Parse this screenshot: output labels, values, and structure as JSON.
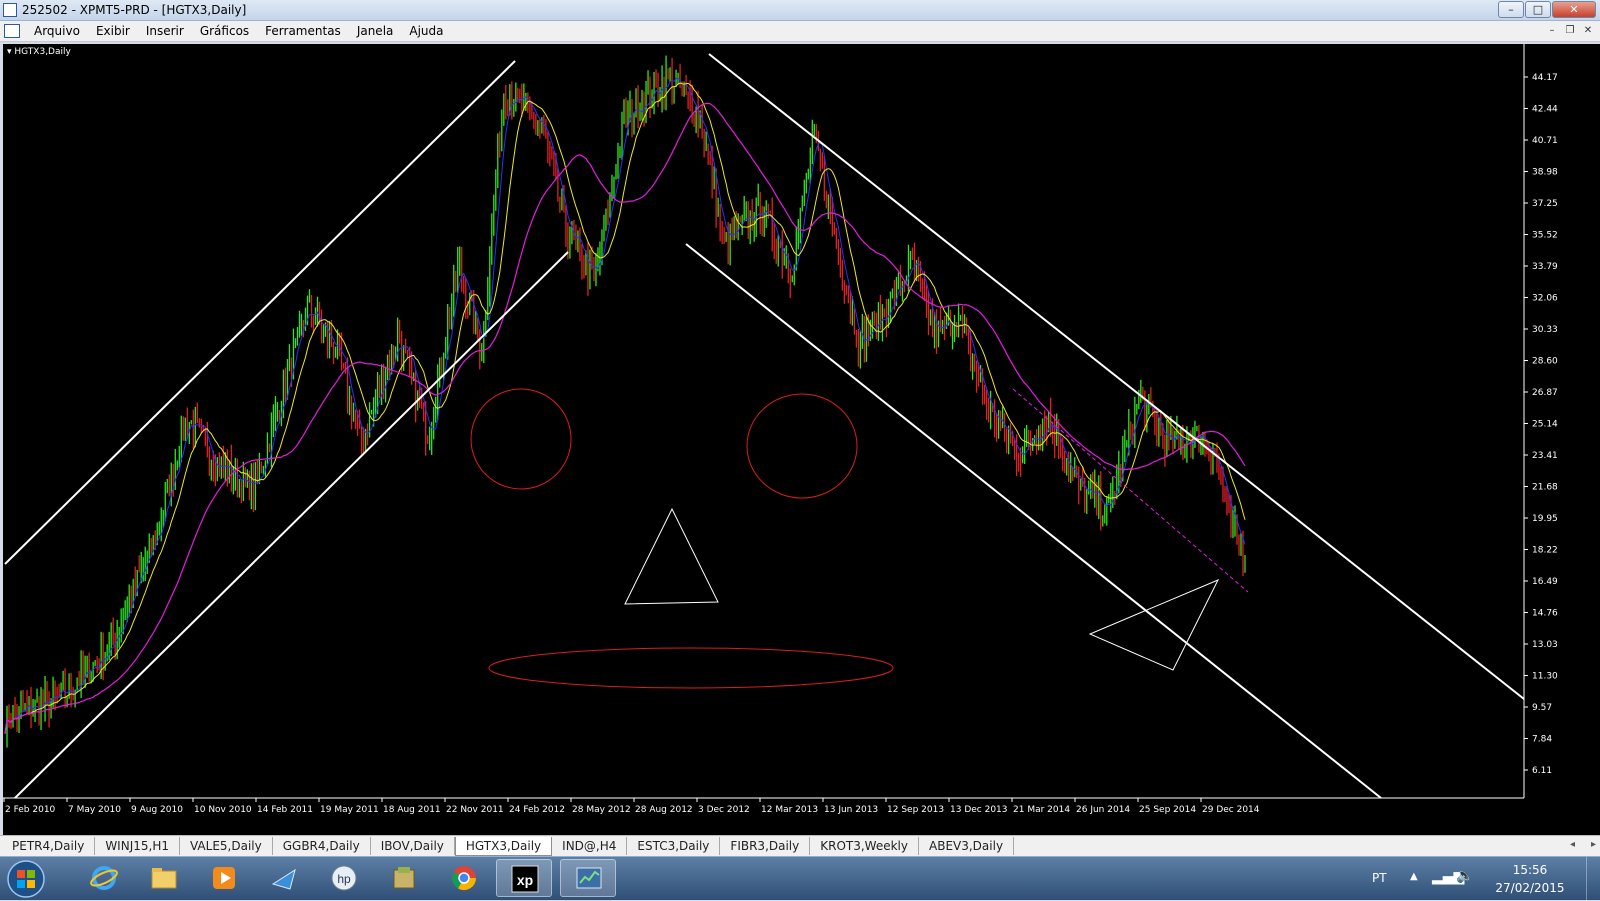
{
  "window": {
    "title": "252502 - XPMT5-PRD - [HGTX3,Daily]",
    "minimize": "–",
    "maximize": "□",
    "close": "✕"
  },
  "menu": {
    "items": [
      "Arquivo",
      "Exibir",
      "Inserir",
      "Gráficos",
      "Ferramentas",
      "Janela",
      "Ajuda"
    ],
    "mdi_minimize": "–",
    "mdi_restore": "❐",
    "mdi_close": "✕"
  },
  "chart": {
    "symbol_label": "HGTX3,Daily",
    "price_levels": [
      "44.17",
      "42.44",
      "40.71",
      "38.98",
      "37.25",
      "35.52",
      "33.79",
      "32.06",
      "30.33",
      "28.60",
      "26.87",
      "25.14",
      "23.41",
      "21.68",
      "19.95",
      "18.22",
      "16.49",
      "14.76",
      "13.03",
      "11.30",
      "9.57",
      "7.84",
      "6.11"
    ],
    "date_labels": [
      "2 Feb 2010",
      "7 May 2010",
      "9 Aug 2010",
      "10 Nov 2010",
      "14 Feb 2011",
      "19 May 2011",
      "18 Aug 2011",
      "22 Nov 2011",
      "24 Feb 2012",
      "28 May 2012",
      "28 Aug 2012",
      "3 Dec 2012",
      "12 Mar 2013",
      "13 Jun 2013",
      "12 Sep 2013",
      "13 Dec 2013",
      "21 Mar 2014",
      "26 Jun 2014",
      "25 Sep 2014",
      "29 Dec 2014"
    ],
    "close_anchors": [
      [
        0,
        8.9
      ],
      [
        0.04,
        10.2
      ],
      [
        0.07,
        13
      ],
      [
        0.1,
        19
      ],
      [
        0.12,
        25.5
      ],
      [
        0.14,
        23
      ],
      [
        0.165,
        21.5
      ],
      [
        0.2,
        31.5
      ],
      [
        0.22,
        29
      ],
      [
        0.235,
        24
      ],
      [
        0.26,
        30
      ],
      [
        0.28,
        24.5
      ],
      [
        0.3,
        34
      ],
      [
        0.315,
        29
      ],
      [
        0.33,
        43.5
      ],
      [
        0.355,
        41.5
      ],
      [
        0.37,
        36
      ],
      [
        0.39,
        33
      ],
      [
        0.41,
        42
      ],
      [
        0.44,
        44.2
      ],
      [
        0.46,
        42
      ],
      [
        0.475,
        35
      ],
      [
        0.5,
        37
      ],
      [
        0.52,
        33.5
      ],
      [
        0.535,
        41
      ],
      [
        0.55,
        35
      ],
      [
        0.565,
        29.5
      ],
      [
        0.58,
        31
      ],
      [
        0.6,
        34
      ],
      [
        0.615,
        30
      ],
      [
        0.63,
        31
      ],
      [
        0.65,
        26
      ],
      [
        0.67,
        23.5
      ],
      [
        0.69,
        25.5
      ],
      [
        0.71,
        21.5
      ],
      [
        0.73,
        20.5
      ],
      [
        0.75,
        26.5
      ],
      [
        0.77,
        24
      ],
      [
        0.79,
        24.5
      ],
      [
        0.8,
        23.5
      ],
      [
        0.81,
        19.5
      ],
      [
        0.82,
        18
      ]
    ],
    "colors": {
      "background": "#000000",
      "candles": "#2ee81e",
      "candles_down": "#e22121",
      "ma_fast": "#2433ff",
      "ma_mid": "#f0ea1e",
      "ma_slow": "#e21edd",
      "trendlines": "#ffffff",
      "face_red": "#d81e1e",
      "channel_dash": "#e21edd"
    }
  },
  "tabs": [
    "PETR4,Daily",
    "WINJ15,H1",
    "VALE5,Daily",
    "GGBR4,Daily",
    "IBOV,Daily",
    "HGTX3,Daily",
    "IND@,H4",
    "ESTC3,Daily",
    "FIBR3,Daily",
    "KROT3,Weekly",
    "ABEV3,Daily"
  ],
  "active_tab": "HGTX3,Daily",
  "tabs_nav": {
    "left": "◂",
    "right": "▸"
  },
  "taskbar": {
    "icons": [
      "windows-start-icon",
      "internet-explorer-icon",
      "file-explorer-icon",
      "media-player-icon",
      "network-app-icon",
      "hp-icon",
      "archive-tool-icon",
      "chrome-icon",
      "xp-investimentos-icon",
      "trading-terminal-icon"
    ],
    "xp_label": "xp",
    "hp_label": "hp",
    "lang": "PT",
    "time": "15:56",
    "date": "27/02/2015"
  }
}
